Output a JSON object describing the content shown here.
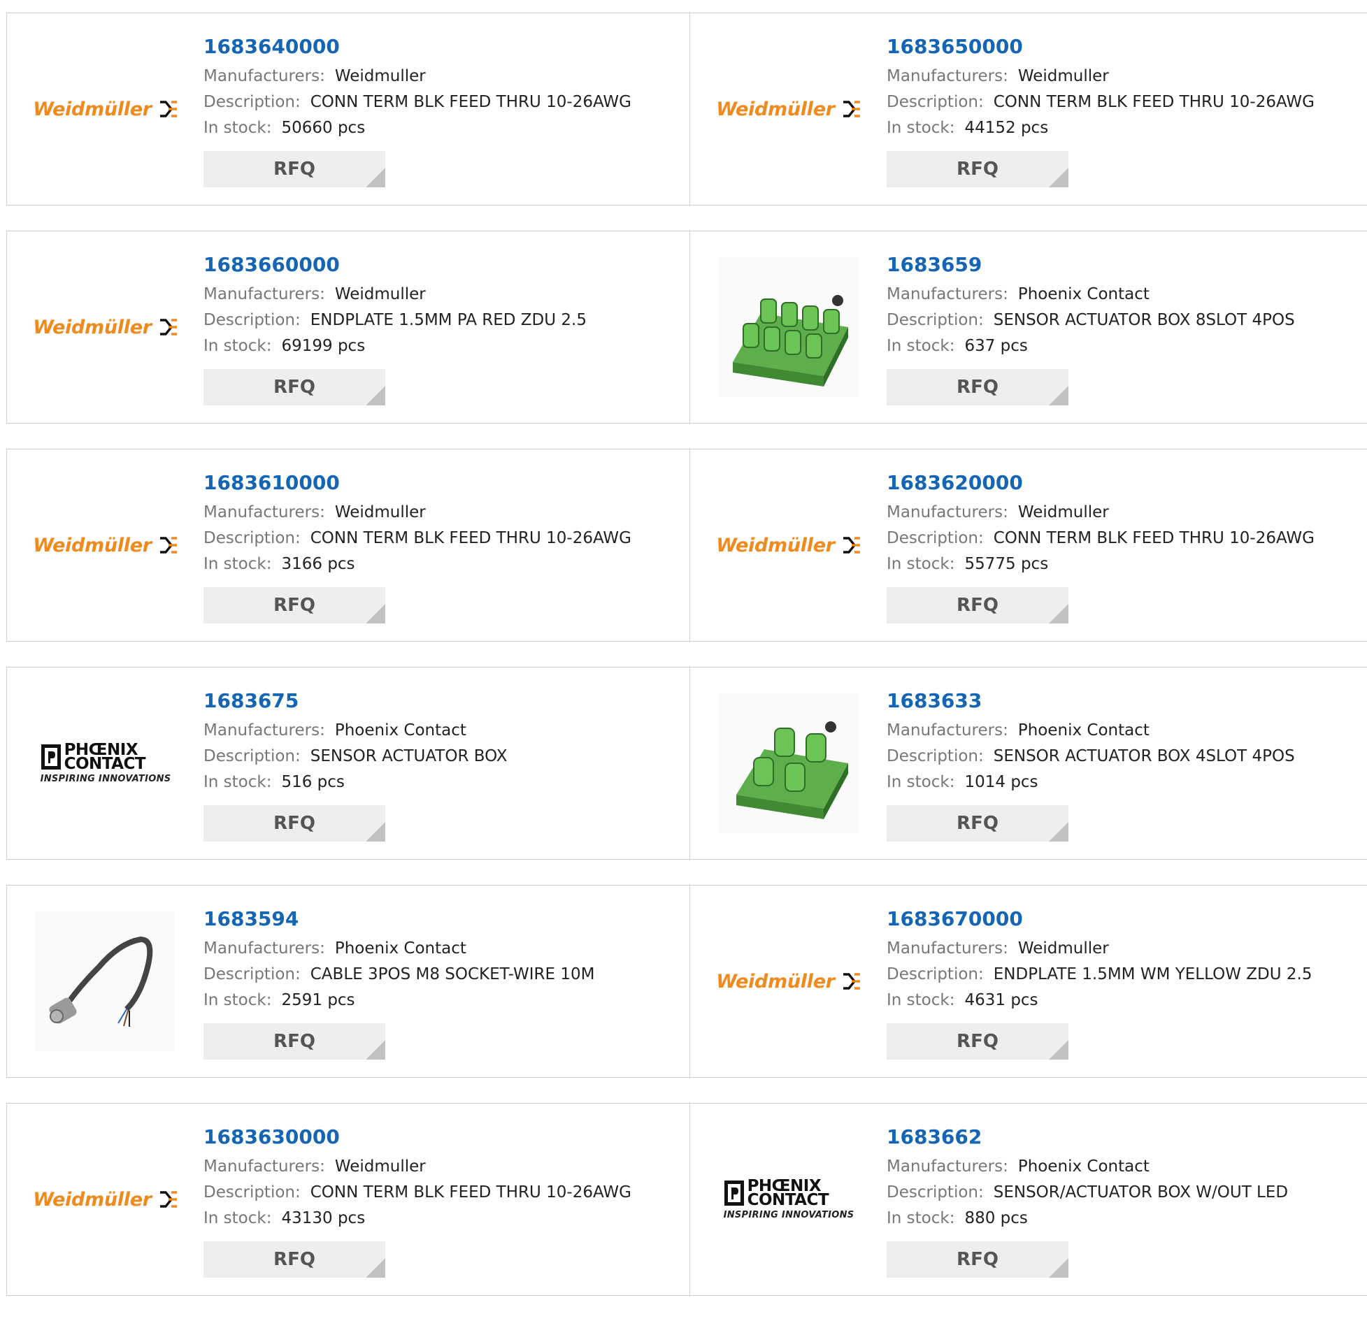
{
  "labels": {
    "manufacturers": "Manufacturers:",
    "description": "Description:",
    "in_stock": "In stock:",
    "rfq": "RFQ"
  },
  "brand_logos": {
    "weidmuller": "Weidmüller",
    "phoenix_line1": "PHŒNIX",
    "phoenix_line2": "CONTACT",
    "phoenix_tagline": "INSPIRING INNOVATIONS"
  },
  "colors": {
    "link": "#1565b5",
    "weidmuller": "#f08a1c",
    "button_bg": "#eeeeee"
  },
  "products": [
    {
      "pn": "1683640000",
      "manufacturer": "Weidmuller",
      "description": "CONN TERM BLK FEED THRU 10-26AWG",
      "stock": "50660 pcs",
      "image": "weidmuller-logo"
    },
    {
      "pn": "1683650000",
      "manufacturer": "Weidmuller",
      "description": "CONN TERM BLK FEED THRU 10-26AWG",
      "stock": "44152 pcs",
      "image": "weidmuller-logo"
    },
    {
      "pn": "1683660000",
      "manufacturer": "Weidmuller",
      "description": "ENDPLATE 1.5MM PA RED ZDU 2.5",
      "stock": "69199 pcs",
      "image": "weidmuller-logo"
    },
    {
      "pn": "1683659",
      "manufacturer": "Phoenix Contact",
      "description": "SENSOR ACTUATOR BOX 8SLOT 4POS",
      "stock": "637 pcs",
      "image": "sensor-box-8slot-image"
    },
    {
      "pn": "1683610000",
      "manufacturer": "Weidmuller",
      "description": "CONN TERM BLK FEED THRU 10-26AWG",
      "stock": "3166 pcs",
      "image": "weidmuller-logo"
    },
    {
      "pn": "1683620000",
      "manufacturer": "Weidmuller",
      "description": "CONN TERM BLK FEED THRU 10-26AWG",
      "stock": "55775 pcs",
      "image": "weidmuller-logo"
    },
    {
      "pn": "1683675",
      "manufacturer": "Phoenix Contact",
      "description": "SENSOR ACTUATOR BOX",
      "stock": "516 pcs",
      "image": "phoenix-contact-logo"
    },
    {
      "pn": "1683633",
      "manufacturer": "Phoenix Contact",
      "description": "SENSOR ACTUATOR BOX 4SLOT 4POS",
      "stock": "1014 pcs",
      "image": "sensor-box-4slot-image"
    },
    {
      "pn": "1683594",
      "manufacturer": "Phoenix Contact",
      "description": "CABLE 3POS M8 SOCKET-WIRE 10M",
      "stock": "2591 pcs",
      "image": "cable-image"
    },
    {
      "pn": "1683670000",
      "manufacturer": "Weidmuller",
      "description": "ENDPLATE 1.5MM WM YELLOW ZDU 2.5",
      "stock": "4631 pcs",
      "image": "weidmuller-logo"
    },
    {
      "pn": "1683630000",
      "manufacturer": "Weidmuller",
      "description": "CONN TERM BLK FEED THRU 10-26AWG",
      "stock": "43130 pcs",
      "image": "weidmuller-logo"
    },
    {
      "pn": "1683662",
      "manufacturer": "Phoenix Contact",
      "description": "SENSOR/ACTUATOR BOX W/OUT LED",
      "stock": "880 pcs",
      "image": "phoenix-contact-logo"
    }
  ]
}
